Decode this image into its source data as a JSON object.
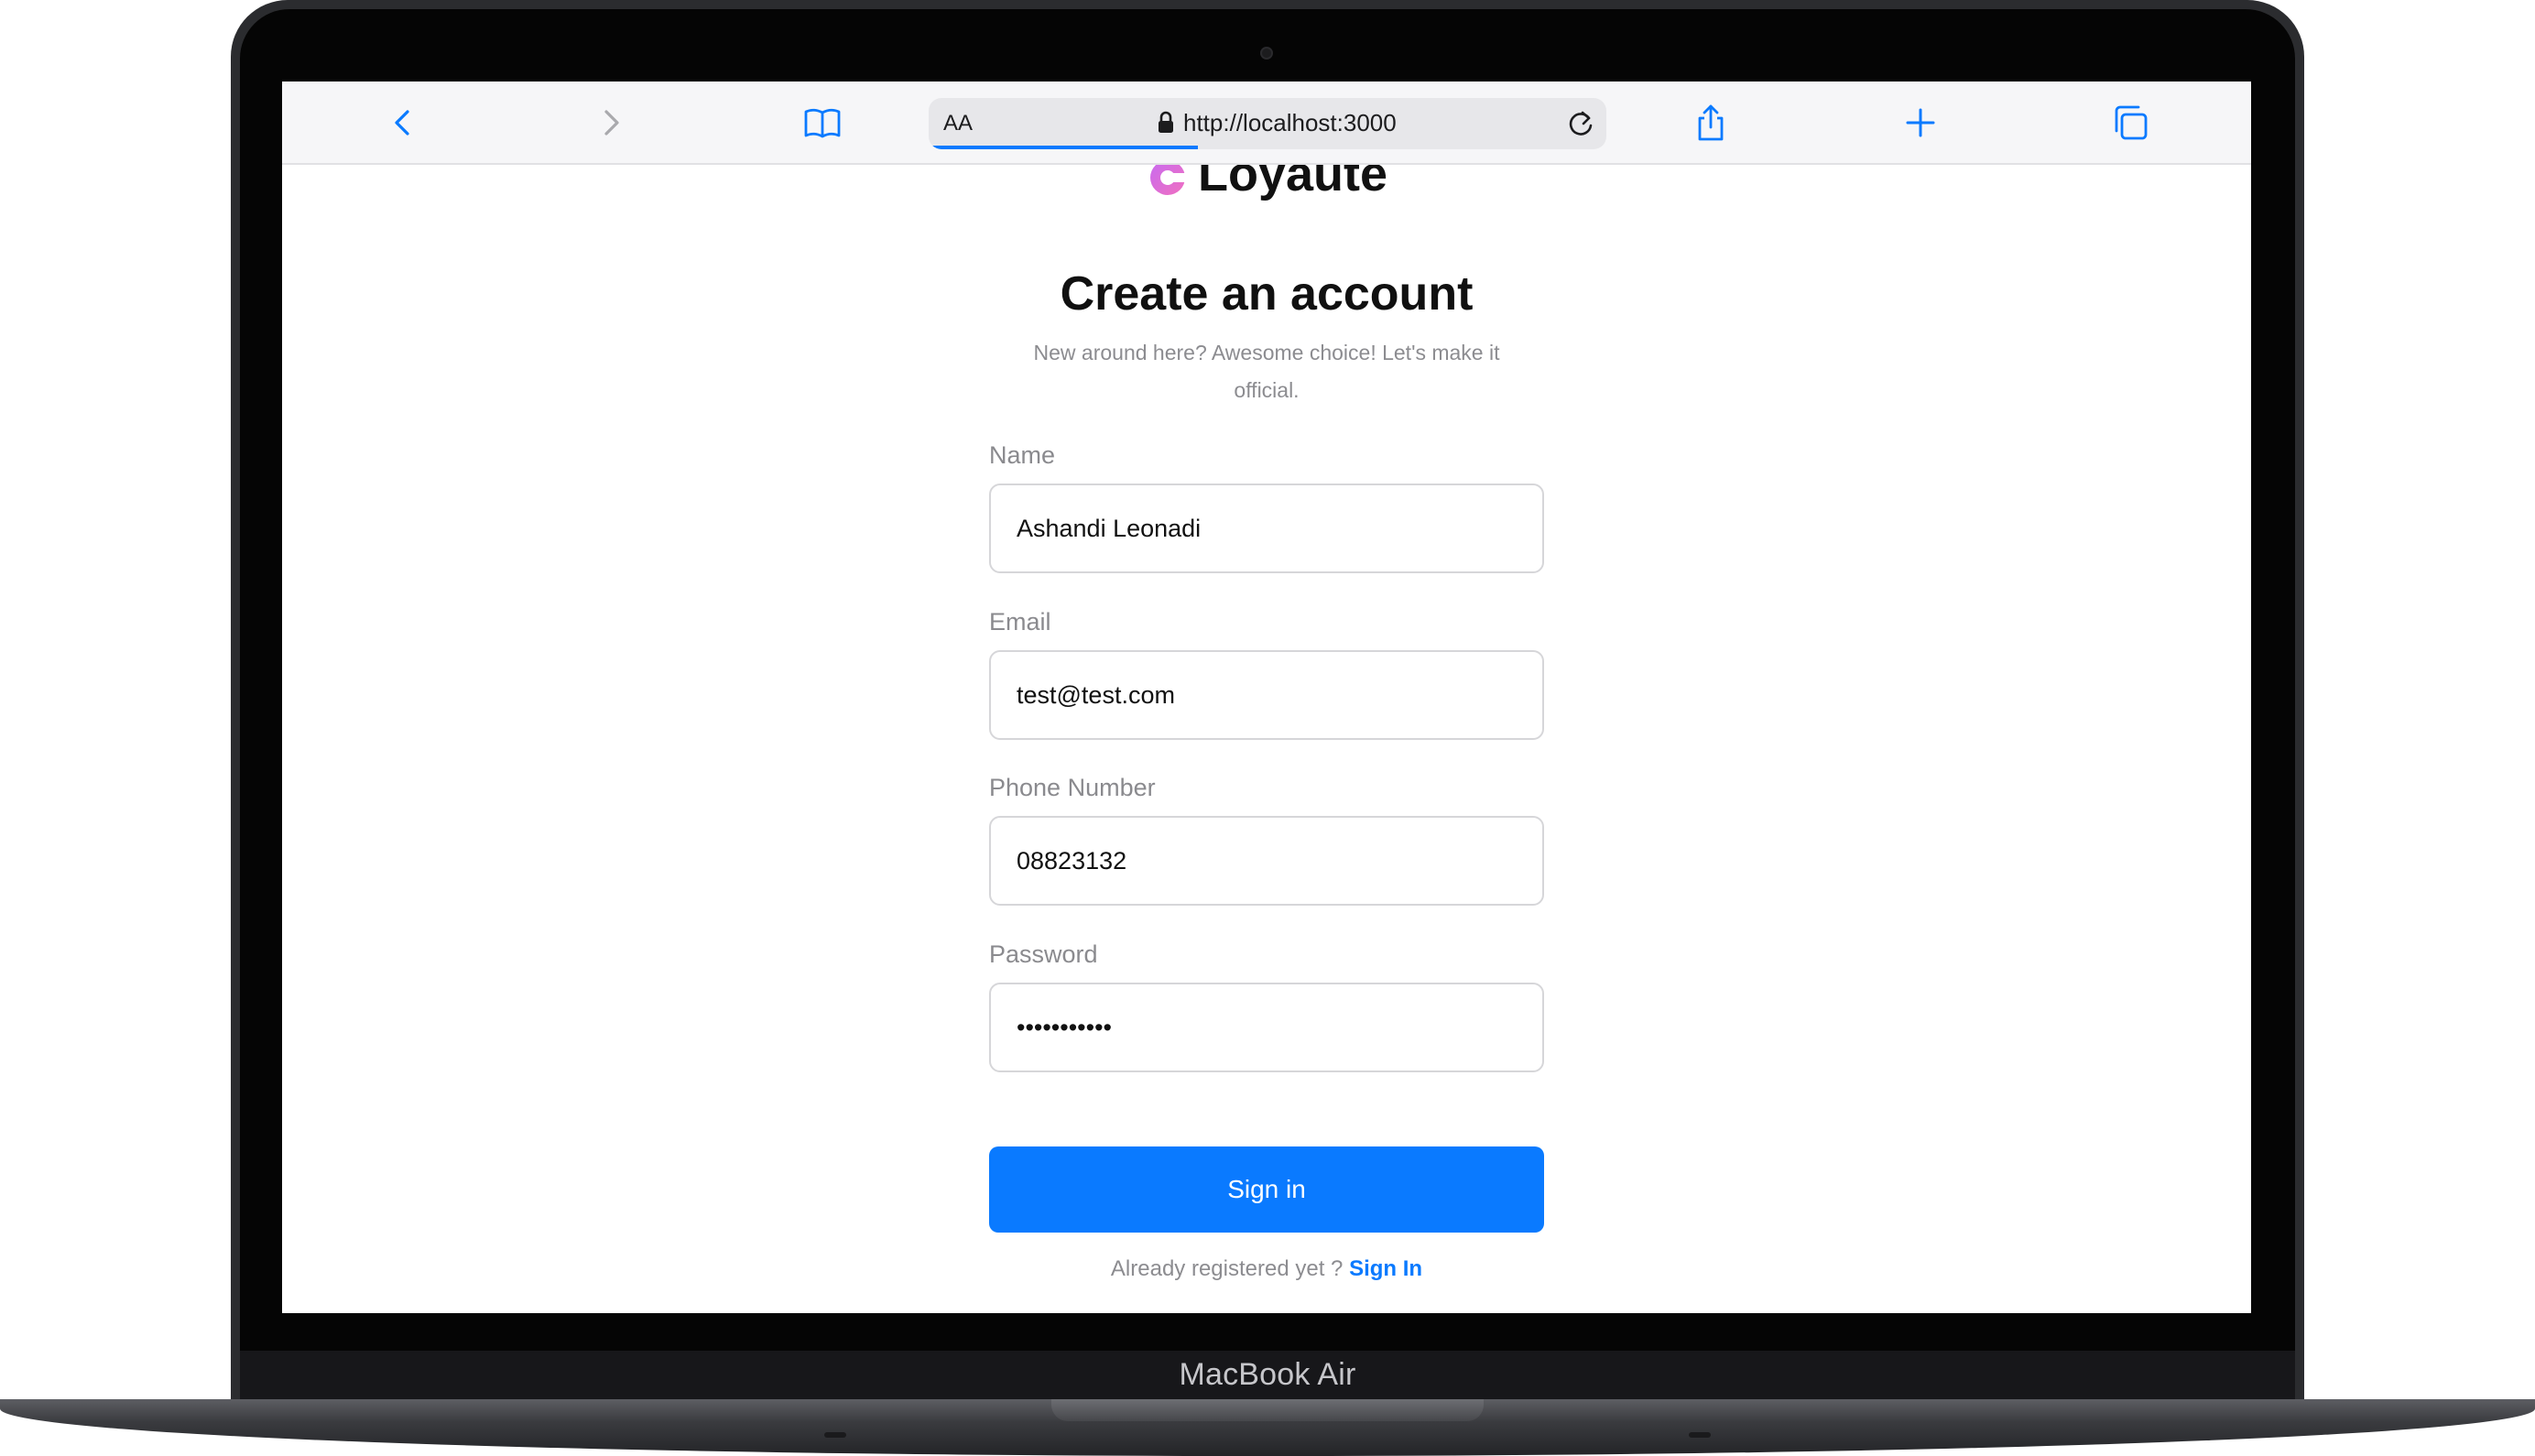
{
  "device": {
    "label": "MacBook Air"
  },
  "browser": {
    "text_size_label": "AA",
    "url": "http://localhost:3000",
    "accent_color": "#0a7aff",
    "icons": [
      "back-icon",
      "forward-icon",
      "bookmarks-icon",
      "lock-icon",
      "reload-icon",
      "share-icon",
      "new-tab-icon",
      "tabs-icon"
    ]
  },
  "page": {
    "brand": "Loyaute",
    "title": "Create an account",
    "subtitle": "New around here? Awesome choice! Let's make it official.",
    "fields": {
      "name": {
        "label": "Name",
        "value": "Ashandi Leonadi"
      },
      "email": {
        "label": "Email",
        "value": "test@test.com"
      },
      "phone": {
        "label": "Phone Number",
        "value": "08823132"
      },
      "password": {
        "label": "Password",
        "value": "•••••••••••"
      }
    },
    "submit_label": "Sign in",
    "footer": {
      "prompt": "Already registered yet ?",
      "link": "Sign In"
    }
  }
}
